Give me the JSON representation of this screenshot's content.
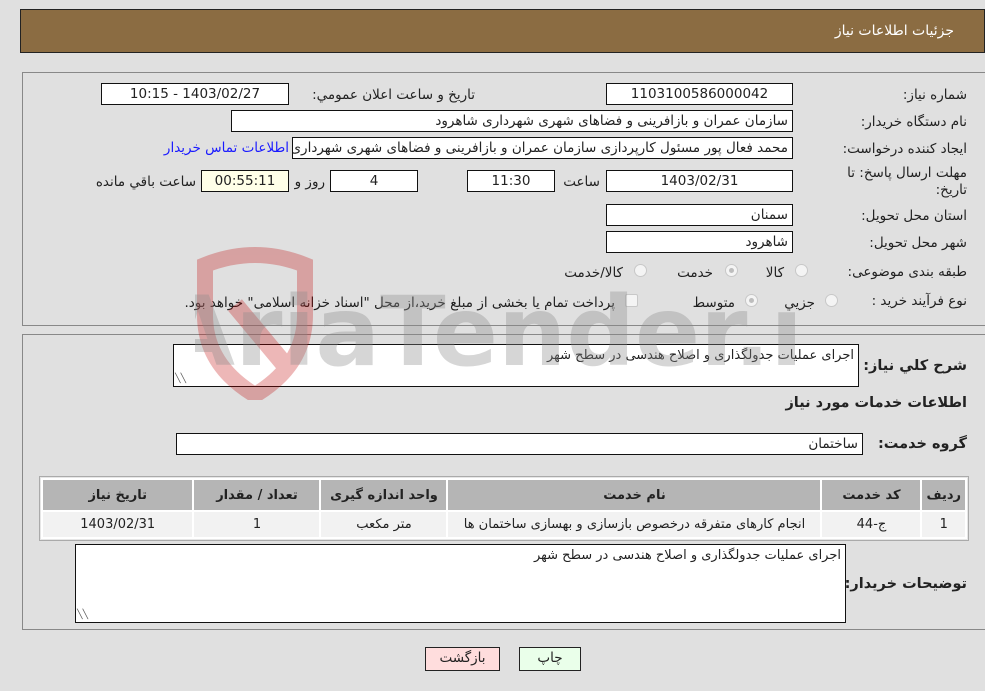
{
  "header": {
    "title": "جزئیات اطلاعات نیاز"
  },
  "form": {
    "need_number": {
      "label": "شماره نیاز:",
      "value": "1103100586000042"
    },
    "announce_datetime": {
      "label": "تاریخ و ساعت اعلان عمومي:",
      "value": "1403/02/27 - 10:15"
    },
    "buyer_org": {
      "label": "نام دستگاه خريدار:",
      "value": "سازمان عمران و بازافرینی و فضاهای شهری شهرداری شاهرود"
    },
    "requester": {
      "label": "ايجاد کننده درخواست:",
      "value": "محمد فعال پور مسئول کارپردازی سازمان عمران و بازافرینی و فضاهای شهری شهرداری شاهرود",
      "contact_link": "اطلاعات تماس خريدار"
    },
    "deadline": {
      "label": "مهلت ارسال پاسخ: تا تاریخ:",
      "date": "1403/02/31",
      "time_label": "ساعت",
      "time": "11:30",
      "days": "4",
      "days_label": "روز و",
      "remaining": "00:55:11",
      "remaining_label": "ساعت باقي مانده"
    },
    "province": {
      "label": "استان محل تحویل:",
      "value": "سمنان"
    },
    "city": {
      "label": "شهر محل تحویل:",
      "value": "شاهرود"
    },
    "category": {
      "label": "طبقه بندی موضوعی:",
      "options": [
        {
          "label": "کالا",
          "checked": false
        },
        {
          "label": "خدمت",
          "checked": true
        },
        {
          "label": "کالا/خدمت",
          "checked": false
        }
      ]
    },
    "purchase_type": {
      "label": "نوع فرآیند خرید :",
      "options": [
        {
          "label": "جزيي",
          "checked": false
        },
        {
          "label": "متوسط",
          "checked": true
        }
      ],
      "treasury_note": "پرداخت تمام یا بخشی از مبلغ خرید،از محل \"اسناد خزانه اسلامی\" خواهد بود."
    }
  },
  "details": {
    "general_desc": {
      "label": "شرح کلي نياز:",
      "value": "اجرای عملیات جدولگذاری و اصلاح هندسی در سطح شهر"
    },
    "services_title": "اطلاعات خدمات مورد نياز",
    "service_group": {
      "label": "گروه خدمت:",
      "value": "ساختمان"
    },
    "table": {
      "columns": [
        "رديف",
        "کد خدمت",
        "نام خدمت",
        "واحد اندازه گيری",
        "تعداد / مقدار",
        "تاريخ نياز"
      ],
      "rows": [
        [
          "1",
          "ج-44",
          "انجام کارهای متفرقه درخصوص بازسازی و بهسازی ساختمان ها",
          "متر مکعب",
          "1",
          "1403/02/31"
        ]
      ]
    },
    "buyer_notes": {
      "label": "توضيحات خريدار:",
      "value": "اجرای عملیات جدولگذاری و اصلاح هندسی در سطح شهر"
    }
  },
  "buttons": {
    "print": "چاپ",
    "back": "بازگشت"
  },
  "watermark": {
    "text": "AriaTender.neT"
  },
  "colors": {
    "header_bg": "#8b6c42",
    "print_bg": "#eaffea",
    "back_bg": "#ffdddd",
    "link": "#1a1aff"
  }
}
